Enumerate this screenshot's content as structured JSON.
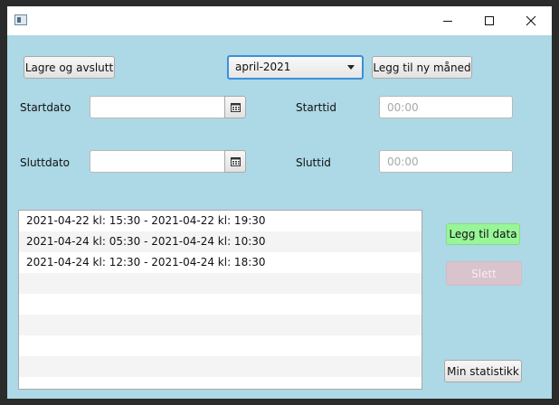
{
  "window": {
    "controls": {
      "minimize": "minimize-icon",
      "maximize": "maximize-icon",
      "close": "close-icon"
    }
  },
  "toolbar": {
    "save_exit_label": "Lagre og avslutt",
    "month_select_value": "april-2021",
    "add_month_label": "Legg til ny måned"
  },
  "form": {
    "start_date_label": "Startdato",
    "start_date_value": "",
    "start_time_label": "Starttid",
    "start_time_placeholder": "00:00",
    "end_date_label": "Sluttdato",
    "end_date_value": "",
    "end_time_label": "Sluttid",
    "end_time_placeholder": "00:00"
  },
  "entries": [
    "2021-04-22 kl: 15:30 - 2021-04-22 kl: 19:30",
    "2021-04-24 kl: 05:30 - 2021-04-24 kl: 10:30",
    "2021-04-24 kl: 12:30 - 2021-04-24 kl: 18:30",
    "",
    "",
    "",
    "",
    "",
    ""
  ],
  "actions": {
    "add_data_label": "Legg til data",
    "delete_label": "Slett",
    "statistics_label": "Min statistikk"
  },
  "colors": {
    "background": "#add8e6",
    "add_button": "#98f598",
    "delete_button_disabled": "#d9c3cc",
    "focus_border": "#3b8fd9"
  }
}
